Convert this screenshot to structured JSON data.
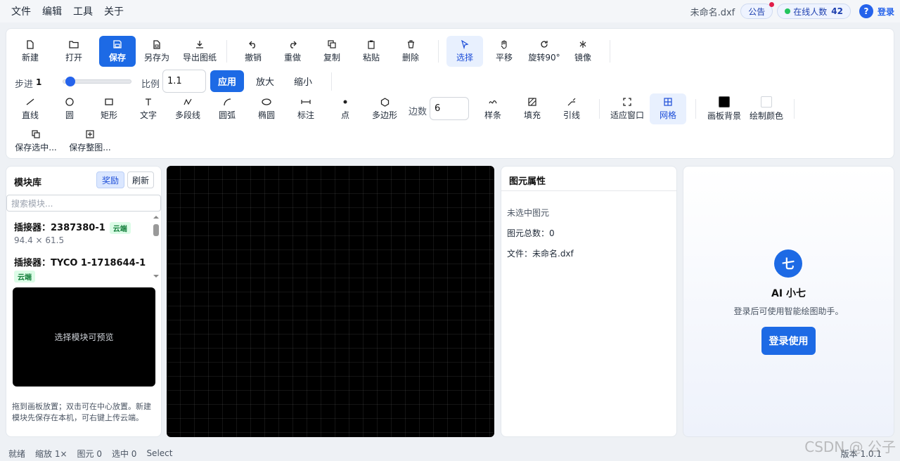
{
  "menu": {
    "file": "文件",
    "edit": "编辑",
    "tools": "工具",
    "about": "关于"
  },
  "header": {
    "filename": "未命名.dxf",
    "notice": "公告",
    "online_label": "在线人数",
    "online_count": "42",
    "help": "?",
    "login": "登录"
  },
  "toolbar": {
    "row1": {
      "new": "新建",
      "open": "打开",
      "save": "保存",
      "save_as": "另存为",
      "export": "导出图纸",
      "undo": "撤销",
      "redo": "重做",
      "copy": "复制",
      "paste": "粘贴",
      "delete": "删除",
      "select": "选择",
      "pan": "平移",
      "rotate": "旋转90°",
      "mirror": "镜像"
    },
    "row2": {
      "step_label": "步进",
      "step_value": "1",
      "step_fraction": 0.05,
      "scale_label": "比例",
      "scale_value": "1.1",
      "apply": "应用",
      "zoom_in": "放大",
      "zoom_out": "缩小"
    },
    "row3": {
      "line": "直线",
      "circle": "圆",
      "rect": "矩形",
      "text": "文字",
      "polyline": "多段线",
      "arc": "圆弧",
      "ellipse": "椭圆",
      "dimension": "标注",
      "point": "点",
      "polygon": "多边形",
      "sides_label": "边数",
      "sides_value": "6",
      "spline": "样条",
      "fill": "填充",
      "leader": "引线",
      "fit": "适应窗口",
      "grid": "网格",
      "bg_color_label": "画板背景",
      "draw_color_label": "绘制颜色"
    },
    "row4": {
      "save_selection": "保存选中...",
      "save_whole": "保存整图..."
    },
    "colors": {
      "board_bg": "#000000",
      "draw_color": "#ffffff",
      "accent": "#1d6ae5"
    }
  },
  "library": {
    "title": "模块库",
    "reward": "奖励",
    "refresh": "刷新",
    "search_placeholder": "搜索模块...",
    "items": [
      {
        "name": "插接器：2387380-1",
        "tag": "云端",
        "size": "94.4 × 61.5"
      },
      {
        "name": "插接器：TYCO 1-1718644-1",
        "tag": "云端"
      }
    ],
    "preview_text": "选择模块可预览",
    "hint": "拖到画板放置；双击可在中心放置。新建模块先保存在本机，可右键上传云端。"
  },
  "properties": {
    "title": "图元属性",
    "none_selected": "未选中图元",
    "total": "图元总数：0",
    "file": "文件：未命名.dxf"
  },
  "ai": {
    "avatar": "七",
    "name": "AI 小七",
    "desc": "登录后可使用智能绘图助手。",
    "login_button": "登录使用"
  },
  "status": {
    "ready": "就绪",
    "zoom": "缩放 1×",
    "entities": "图元 0",
    "selected": "选中 0",
    "mode": "Select",
    "version": "版本 1.0.1"
  },
  "watermark": "CSDN @ 公子"
}
